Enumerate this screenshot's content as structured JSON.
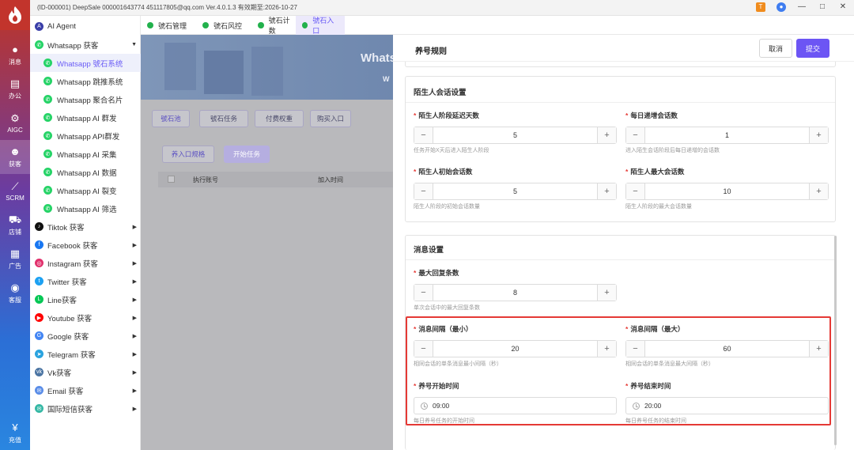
{
  "titlebar": {
    "text": "(ID-000001)  DeepSale 000001643774 451117805@qq.com   Ver.4.0.1.3 有效期至:2026-10-27",
    "icons": [
      "notification-icon",
      "user-icon",
      "minimize-icon",
      "maximize-icon",
      "close-icon"
    ]
  },
  "rail": {
    "items": [
      {
        "label": "消息",
        "icon": "chat-icon"
      },
      {
        "label": "办公",
        "icon": "briefcase-icon"
      },
      {
        "label": "AIGC",
        "icon": "aigc-icon"
      },
      {
        "label": "获客",
        "icon": "users-icon"
      },
      {
        "label": "SCRM",
        "icon": "chart-icon"
      },
      {
        "label": "店铺",
        "icon": "cart-icon"
      },
      {
        "label": "广告",
        "icon": "ads-icon"
      },
      {
        "label": "客服",
        "icon": "service-icon"
      },
      {
        "label": "充值",
        "icon": "recharge-icon"
      }
    ]
  },
  "sidebar": {
    "items": [
      {
        "label": "AI Agent",
        "icon": "ai-agent-icon",
        "color": "#3a3ea8"
      },
      {
        "label": "Whatsapp 获客",
        "icon": "whatsapp-icon",
        "color": "#25d366"
      },
      {
        "label": "Whatsapp 號石系统",
        "icon": "whatsapp-icon",
        "color": "#25d366"
      },
      {
        "label": "Whatsapp 跳推系统",
        "icon": "whatsapp-icon",
        "color": "#25d366"
      },
      {
        "label": "Whatsapp 聚合名片",
        "icon": "whatsapp-icon",
        "color": "#25d366"
      },
      {
        "label": "Whatsapp AI 群发",
        "icon": "whatsapp-icon",
        "color": "#25d366"
      },
      {
        "label": "Whatsapp API群发",
        "icon": "whatsapp-icon",
        "color": "#25d366"
      },
      {
        "label": "Whatsapp AI 采集",
        "icon": "whatsapp-icon",
        "color": "#25d366"
      },
      {
        "label": "Whatsapp AI 数据",
        "icon": "whatsapp-icon",
        "color": "#25d366"
      },
      {
        "label": "Whatsapp AI 裂变",
        "icon": "whatsapp-icon",
        "color": "#25d366"
      },
      {
        "label": "Whatsapp AI 筛选",
        "icon": "whatsapp-icon",
        "color": "#25d366"
      },
      {
        "label": "Tiktok 获客",
        "icon": "tiktok-icon",
        "color": "#111111"
      },
      {
        "label": "Facebook 获客",
        "icon": "facebook-icon",
        "color": "#1877f2"
      },
      {
        "label": "Instagram 获客",
        "icon": "instagram-icon",
        "color": "#e1306c"
      },
      {
        "label": "Twitter 获客",
        "icon": "twitter-icon",
        "color": "#1da1f2"
      },
      {
        "label": "Line获客",
        "icon": "line-icon",
        "color": "#06c755"
      },
      {
        "label": "Youtube 获客",
        "icon": "youtube-icon",
        "color": "#ff0000"
      },
      {
        "label": "Google 获客",
        "icon": "google-icon",
        "color": "#4285f4"
      },
      {
        "label": "Telegram 获客",
        "icon": "telegram-icon",
        "color": "#2aa3df"
      },
      {
        "label": "Vk获客",
        "icon": "vk-icon",
        "color": "#4c75a3"
      },
      {
        "label": "Email 获客",
        "icon": "email-icon",
        "color": "#5a8de8"
      },
      {
        "label": "国际短信获客",
        "icon": "sms-icon",
        "color": "#35b8a5"
      }
    ]
  },
  "tabs": [
    {
      "label": "號石管理"
    },
    {
      "label": "號石风控"
    },
    {
      "label": "號石计数"
    },
    {
      "label": "號石入口"
    }
  ],
  "background": {
    "banner_title": "Whats",
    "banner_sub": "W",
    "buttons": [
      "號石池",
      "號石任务",
      "付费权重",
      "购买入口"
    ],
    "action_buttons": [
      "养入口规格",
      "开始任务"
    ],
    "table_headers": [
      "执行账号",
      "加入时间"
    ]
  },
  "drawer": {
    "title": "养号规则",
    "cancel_label": "取消",
    "submit_label": "提交",
    "stranger_section": {
      "title": "陌生人会话设置",
      "fields": [
        {
          "label": "陌生人阶段延迟天数",
          "value": "5",
          "hint": "任务开始X天后进入陌生人阶段"
        },
        {
          "label": "每日递增会话数",
          "value": "1",
          "hint": "进入陌生会话阶段后每日递增的会话数"
        },
        {
          "label": "陌生人初始会话数",
          "value": "5",
          "hint": "陌生人阶段的初始会话数量"
        },
        {
          "label": "陌生人最大会话数",
          "value": "10",
          "hint": "陌生人阶段的最大会话数量"
        }
      ]
    },
    "message_section": {
      "title": "消息设置",
      "max_reply": {
        "label": "最大回复条数",
        "value": "8",
        "hint": "单次会话中的最大回复条数"
      },
      "interval_min": {
        "label": "消息间隔（最小）",
        "value": "20",
        "hint": "相同会话的单条消息最小间隔（秒）"
      },
      "interval_max": {
        "label": "消息间隔（最大）",
        "value": "60",
        "hint": "相同会话的单条消息最大间隔（秒）"
      },
      "start_time": {
        "label": "养号开始时间",
        "value": "09:00",
        "hint": "每日养号任务的开始时间"
      },
      "end_time": {
        "label": "养号结束时间",
        "value": "20:00",
        "hint": "每日养号任务的结束时间"
      }
    }
  },
  "colors": {
    "accent": "#6c55f4",
    "highlight": "#e53935",
    "whatsapp": "#25d366"
  }
}
